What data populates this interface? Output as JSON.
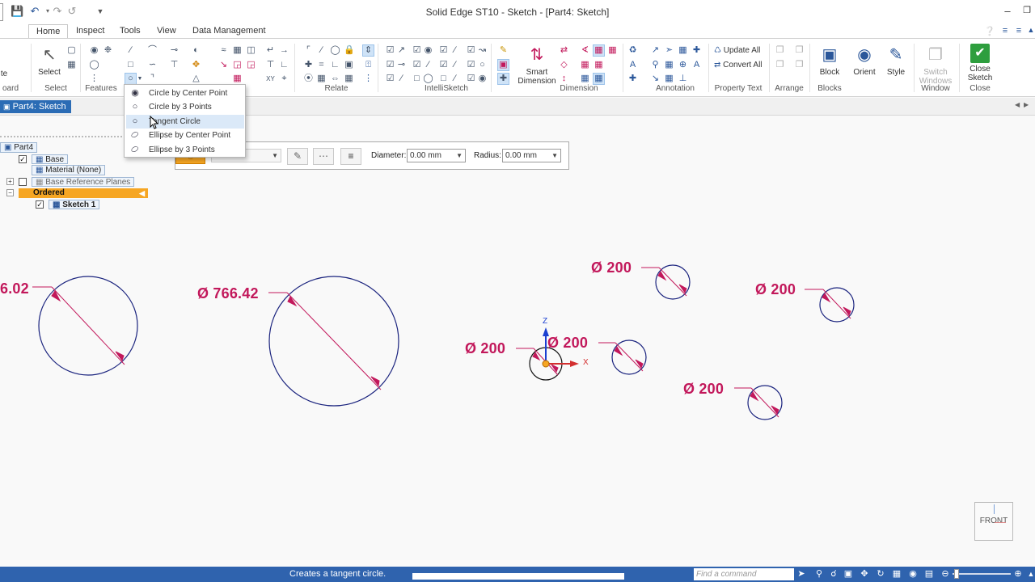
{
  "app": {
    "title": "Solid Edge ST10 - Sketch - [Part4: Sketch]"
  },
  "tabs": [
    {
      "label": "Home"
    },
    {
      "label": "Inspect"
    },
    {
      "label": "Tools"
    },
    {
      "label": "View"
    },
    {
      "label": "Data Management"
    }
  ],
  "ribbon": {
    "groups": {
      "clipboard": "oard",
      "select": "Select",
      "features": "Features",
      "relate": "Relate",
      "intellisketch": "IntelliSketch",
      "dimension": "Dimension",
      "annotation": "Annotation",
      "property_text": "Property Text",
      "arrange": "Arrange",
      "blocks": "Blocks",
      "window": "Window",
      "close": "Close"
    },
    "buttons": {
      "paste": "te",
      "select": "Select",
      "smart_dimension_1": "Smart",
      "smart_dimension_2": "Dimension",
      "update_all": "Update All",
      "convert_all": "Convert All",
      "block": "Block",
      "orient": "Orient",
      "style": "Style",
      "switch_windows_1": "Switch",
      "switch_windows_2": "Windows",
      "close_sketch_1": "Close",
      "close_sketch_2": "Sketch"
    }
  },
  "document_tab": {
    "label": "Part4: Sketch"
  },
  "circle_dropdown": {
    "items": [
      {
        "label": "Circle by Center Point",
        "icon": "circle-center-icon"
      },
      {
        "label": "Circle by 3 Points",
        "icon": "circle-3pt-icon"
      },
      {
        "label": "Tangent Circle",
        "icon": "tangent-circle-icon"
      },
      {
        "label": "Ellipse by Center Point",
        "icon": "ellipse-center-icon"
      },
      {
        "label": "Ellipse by 3 Points",
        "icon": "ellipse-3pt-icon"
      }
    ],
    "highlighted_index": 2
  },
  "command_bar": {
    "diameter_label": "Diameter:",
    "diameter_value": "0.00 mm",
    "radius_label": "Radius:",
    "radius_value": "0.00 mm"
  },
  "pathfinder": {
    "root": "Part4",
    "base": "Base",
    "material": "Material (None)",
    "reference_planes": "Base Reference Planes",
    "ordered": "Ordered",
    "sketch": "Sketch 1"
  },
  "dimensions": [
    {
      "id": "d1",
      "text": "6.02"
    },
    {
      "id": "d2",
      "text": "Ø 766.42"
    },
    {
      "id": "d3",
      "text": "Ø 200"
    },
    {
      "id": "d4",
      "text": "Ø 200"
    },
    {
      "id": "d5",
      "text": "Ø 200"
    },
    {
      "id": "d6",
      "text": "Ø 200"
    },
    {
      "id": "d7",
      "text": "Ø 200"
    }
  ],
  "axes": {
    "z_label": "Z",
    "x_label": "X"
  },
  "view_cube": {
    "label": "FRONT"
  },
  "status_bar": {
    "message": "Creates a tangent circle.",
    "find_command_placeholder": "Find a command"
  },
  "colors": {
    "dimension": "#c2185b",
    "sketch_geometry": "#1a237e",
    "status_bar": "#2f63ae",
    "highlight": "#dbe9f8",
    "selected_node": "#f6a623"
  }
}
